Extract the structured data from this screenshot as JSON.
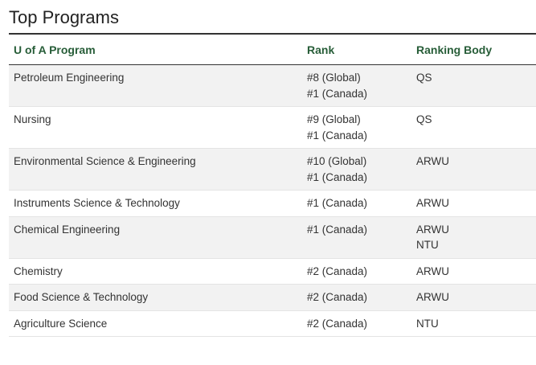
{
  "page": {
    "title": "Top Programs"
  },
  "table": {
    "headers": [
      "U of A Program",
      "Rank",
      "Ranking Body"
    ],
    "rows": [
      {
        "program": "Petroleum Engineering",
        "rank": [
          "#8 (Global)",
          "#1 (Canada)"
        ],
        "body": [
          "QS"
        ]
      },
      {
        "program": "Nursing",
        "rank": [
          "#9 (Global)",
          "#1 (Canada)"
        ],
        "body": [
          "QS"
        ]
      },
      {
        "program": "Environmental Science & Engineering",
        "rank": [
          "#10 (Global)",
          "#1 (Canada)"
        ],
        "body": [
          "ARWU"
        ]
      },
      {
        "program": "Instruments Science & Technology",
        "rank": [
          "#1 (Canada)"
        ],
        "body": [
          "ARWU"
        ]
      },
      {
        "program": "Chemical Engineering",
        "rank": [
          "#1 (Canada)"
        ],
        "body": [
          "ARWU",
          "NTU"
        ]
      },
      {
        "program": "Chemistry",
        "rank": [
          "#2 (Canada)"
        ],
        "body": [
          "ARWU"
        ]
      },
      {
        "program": "Food Science & Technology",
        "rank": [
          "#2 (Canada)"
        ],
        "body": [
          "ARWU"
        ]
      },
      {
        "program": "Agriculture Science",
        "rank": [
          "#2 (Canada)"
        ],
        "body": [
          "NTU"
        ]
      }
    ]
  }
}
